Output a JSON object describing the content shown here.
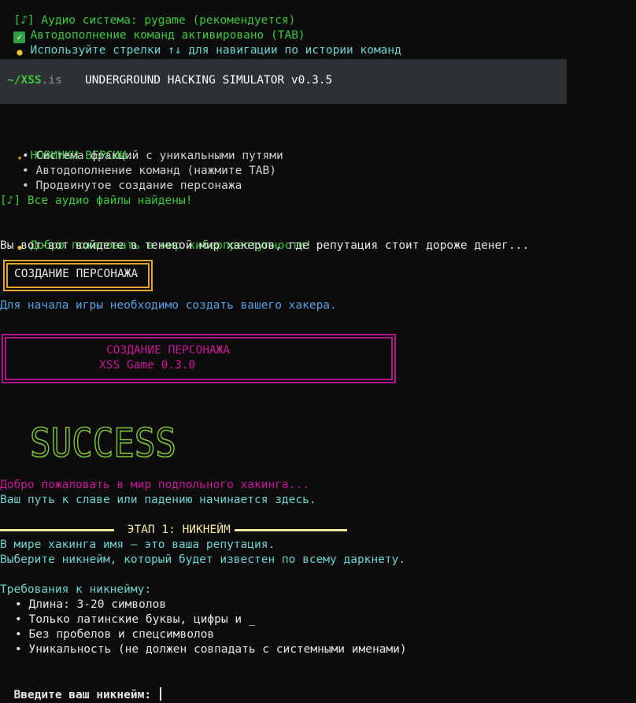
{
  "boot": {
    "audio": "[♪] Аудио система: pygame (рекомендуется)",
    "autocomplete": "Автодополнение команд активировано (TAB)",
    "history_hint": "Используйте стрелки ↑↓ для навигации по истории команд"
  },
  "header": {
    "path": "~/XSS",
    "path_ext": ".is",
    "title": "UNDERGROUND HACKING SIMULATOR v0.3.5"
  },
  "news": {
    "title": "НОВИНКИ ВЕРСИИ:",
    "items": [
      "• Система фракций с уникальными путями",
      "• Автодополнение команд (нажмите TAB)",
      "• Продвинутое создание персонажа"
    ],
    "audio_ok": "[♪] Все аудио файлы найдены!"
  },
  "welcome": {
    "line1": "Добро пожаловать в мир киберпреступности!",
    "line2": "Вы вот-вот войдете в теневой мир хакеров, где репутация стоит дороже денег..."
  },
  "char_box": {
    "label": "СОЗДАНИЕ ПЕРСОНАЖА"
  },
  "intro_line": "Для начала игры необходимо создать вашего хакера.",
  "char_panel": {
    "title": "СОЗДАНИЕ ПЕРСОНАЖА",
    "subtitle": "XSS Game 0.3.0"
  },
  "success_art": "SUCCESS",
  "underground": {
    "line1": "Добро пожаловать в мир подпольного хакинга...",
    "line2": "Ваш путь к славе или падению начинается здесь."
  },
  "stage": {
    "label": " ЭТАП 1: НИКНЕЙМ ",
    "desc1": "В мире хакинга имя — это ваша репутация.",
    "desc2": "Выберите никнейм, который будет известен по всему даркнету."
  },
  "requirements": {
    "title": "Требования к никнейму:",
    "items": [
      "• Длина: 3-20 символов",
      "• Только латинские буквы, цифры и _",
      "• Без пробелов и спецсимволов",
      "• Уникальность (не должен совпадать с системными именами)"
    ]
  },
  "prompt": {
    "label": "Введите ваш никнейм: ",
    "value": ""
  },
  "colors": {
    "green": "#3bc93b",
    "cyan": "#6dd3cf",
    "magenta": "#c8189a",
    "yellow_border": "#e0a62c",
    "stage_rule": "#f0e6a0"
  }
}
